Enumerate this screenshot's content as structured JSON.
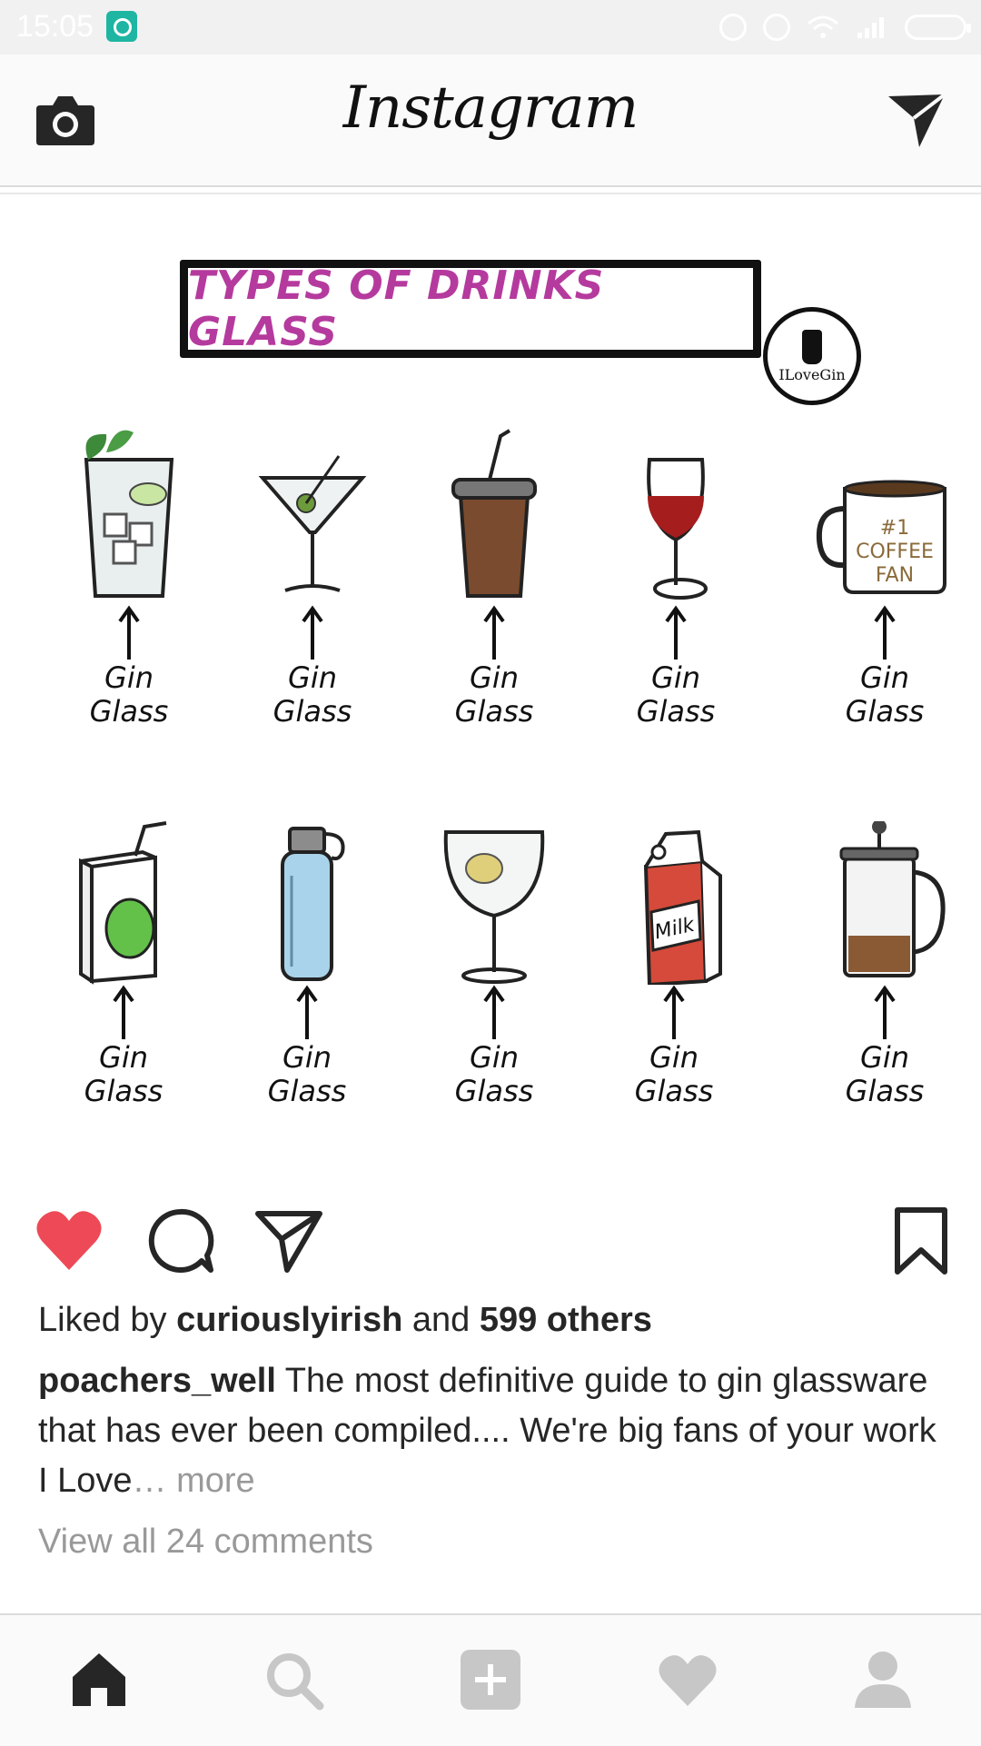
{
  "status_bar": {
    "time": "15:05"
  },
  "top_bar": {
    "logo": "Instagram"
  },
  "post": {
    "image": {
      "banner_title": "TYPES OF DRINKS GLASS",
      "badge_text": "ILoveGin",
      "mug_text": "#1 COFFEE FAN",
      "carton_text": "Milk",
      "items": [
        {
          "drink": "mojito-glass",
          "line1": "Gin",
          "line2": "Glass"
        },
        {
          "drink": "martini-glass",
          "line1": "Gin",
          "line2": "Glass"
        },
        {
          "drink": "coffee-cup",
          "line1": "Gin",
          "line2": "Glass"
        },
        {
          "drink": "wine-glass",
          "line1": "Gin",
          "line2": "Glass"
        },
        {
          "drink": "coffee-mug",
          "line1": "Gin",
          "line2": "Glass"
        },
        {
          "drink": "juice-box",
          "line1": "Gin",
          "line2": "Glass"
        },
        {
          "drink": "water-bottle",
          "line1": "Gin",
          "line2": "Glass"
        },
        {
          "drink": "copa-glass",
          "line1": "Gin",
          "line2": "Glass"
        },
        {
          "drink": "milk-carton",
          "line1": "Gin",
          "line2": "Glass"
        },
        {
          "drink": "french-press",
          "line1": "Gin",
          "line2": "Glass"
        }
      ]
    },
    "liked": true,
    "likes": {
      "prefix": "Liked by ",
      "user": "curiouslyirish",
      "middle": " and ",
      "others": "599 others"
    },
    "caption": {
      "username": "poachers_well",
      "text": " The most definitive guide to gin glassware that has ever been compiled.... We're big fans of your work I Love",
      "ellipsis": "…",
      "more": " more"
    },
    "comments_link": "View all 24 comments"
  },
  "colors": {
    "like_red": "#ed4956",
    "banner_text": "#b53a9e",
    "muted": "#999999"
  },
  "icons": [
    "camera-icon",
    "direct-message-icon",
    "heart-icon",
    "comment-icon",
    "share-icon",
    "bookmark-icon",
    "home-icon",
    "search-icon",
    "add-post-icon",
    "activity-icon",
    "profile-icon"
  ]
}
